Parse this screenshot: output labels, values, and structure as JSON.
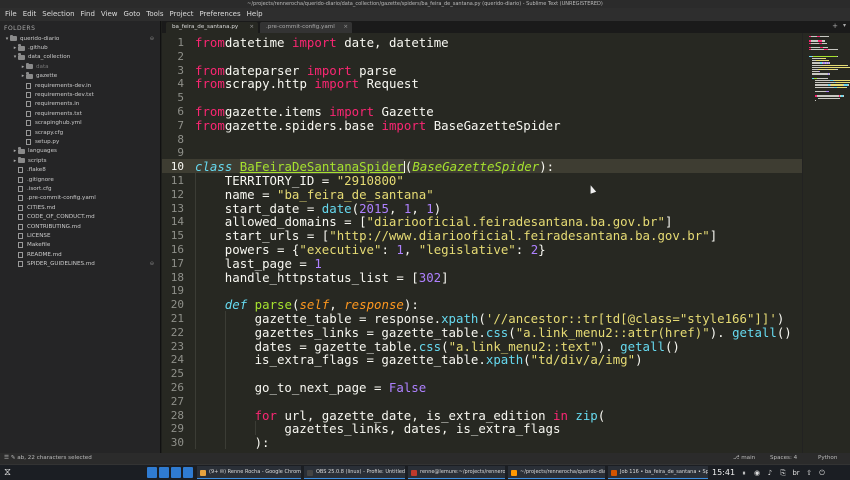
{
  "window": {
    "title": "~/projects/rennerocha/querido-diario/data_collection/gazette/spiders/ba_feira_de_santana.py (querido-diario) - Sublime Text (UNREGISTERED)"
  },
  "menu": [
    "File",
    "Edit",
    "Selection",
    "Find",
    "View",
    "Goto",
    "Tools",
    "Project",
    "Preferences",
    "Help"
  ],
  "sidebar": {
    "heading": "FOLDERS",
    "items": [
      {
        "label": "querido-diario",
        "kind": "folder",
        "depth": 0,
        "expanded": true,
        "close": "⊖"
      },
      {
        "label": ".github",
        "kind": "folder",
        "depth": 1,
        "expanded": false
      },
      {
        "label": "data_collection",
        "kind": "folder",
        "depth": 1,
        "expanded": true
      },
      {
        "label": "data",
        "kind": "folder",
        "depth": 2,
        "expanded": false,
        "dim": true
      },
      {
        "label": "gazette",
        "kind": "folder",
        "depth": 2,
        "expanded": false
      },
      {
        "label": "requirements-dev.in",
        "kind": "file",
        "depth": 2
      },
      {
        "label": "requirements-dev.txt",
        "kind": "file",
        "depth": 2
      },
      {
        "label": "requirements.in",
        "kind": "file",
        "depth": 2
      },
      {
        "label": "requirements.txt",
        "kind": "file",
        "depth": 2
      },
      {
        "label": "scrapinghub.yml",
        "kind": "file",
        "depth": 2
      },
      {
        "label": "scrapy.cfg",
        "kind": "file",
        "depth": 2
      },
      {
        "label": "setup.py",
        "kind": "file",
        "depth": 2
      },
      {
        "label": "languages",
        "kind": "folder",
        "depth": 1,
        "expanded": false
      },
      {
        "label": "scripts",
        "kind": "folder",
        "depth": 1,
        "expanded": false
      },
      {
        "label": ".flake8",
        "kind": "file",
        "depth": 1
      },
      {
        "label": ".gitignore",
        "kind": "file",
        "depth": 1
      },
      {
        "label": ".isort.cfg",
        "kind": "file",
        "depth": 1
      },
      {
        "label": ".pre-commit-config.yaml",
        "kind": "file",
        "depth": 1
      },
      {
        "label": "CITIES.md",
        "kind": "file",
        "depth": 1
      },
      {
        "label": "CODE_OF_CONDUCT.md",
        "kind": "file",
        "depth": 1
      },
      {
        "label": "CONTRIBUTING.md",
        "kind": "file",
        "depth": 1
      },
      {
        "label": "LICENSE",
        "kind": "file",
        "depth": 1
      },
      {
        "label": "Makefile",
        "kind": "file",
        "depth": 1
      },
      {
        "label": "README.md",
        "kind": "file",
        "depth": 1
      },
      {
        "label": "SPIDER_GUIDELINES.md",
        "kind": "file",
        "depth": 1,
        "close": "⊖"
      }
    ]
  },
  "tabs": {
    "active": "ba_feira_de_santana.py",
    "inactive": ".pre-commit-config.yaml",
    "close_glyph": "×",
    "add_glyph": "+",
    "list_glyph": "▾"
  },
  "editor": {
    "current_line": 10,
    "lines": [
      {
        "n": 1,
        "indent": 0,
        "tokens": [
          [
            "kw",
            "from"
          ],
          [
            "",
            "datetime "
          ],
          [
            "kw",
            "import"
          ],
          [
            "",
            " date, datetime"
          ]
        ]
      },
      {
        "n": 2,
        "indent": 0,
        "tokens": []
      },
      {
        "n": 3,
        "indent": 0,
        "tokens": [
          [
            "kw",
            "from"
          ],
          [
            "",
            "dateparser "
          ],
          [
            "kw",
            "import"
          ],
          [
            "",
            " parse"
          ]
        ]
      },
      {
        "n": 4,
        "indent": 0,
        "tokens": [
          [
            "kw",
            "from"
          ],
          [
            "",
            "scrapy.http "
          ],
          [
            "kw",
            "import"
          ],
          [
            "",
            " Request"
          ]
        ]
      },
      {
        "n": 5,
        "indent": 0,
        "tokens": []
      },
      {
        "n": 6,
        "indent": 0,
        "tokens": [
          [
            "kw",
            "from"
          ],
          [
            "",
            "gazette.items "
          ],
          [
            "kw",
            "import"
          ],
          [
            "",
            " Gazette"
          ]
        ]
      },
      {
        "n": 7,
        "indent": 0,
        "tokens": [
          [
            "kw",
            "from"
          ],
          [
            "",
            "gazette.spiders.base "
          ],
          [
            "kw",
            "import"
          ],
          [
            "",
            " BaseGazetteSpider"
          ]
        ]
      },
      {
        "n": 8,
        "indent": 0,
        "tokens": []
      },
      {
        "n": 9,
        "indent": 0,
        "tokens": []
      },
      {
        "n": 10,
        "indent": 0,
        "tokens": [
          [
            "ital",
            "class"
          ],
          [
            "",
            " "
          ],
          [
            "cls sel",
            "BaFeiraDeSantanaSpider"
          ],
          [
            "caret",
            ""
          ],
          [
            "",
            "("
          ],
          [
            "inh",
            "BaseGazetteSpider"
          ],
          [
            "",
            "):"
          ]
        ]
      },
      {
        "n": 11,
        "indent": 1,
        "tokens": [
          [
            "",
            "TERRITORY_ID = "
          ],
          [
            "str",
            "\"2910800\""
          ]
        ]
      },
      {
        "n": 12,
        "indent": 1,
        "tokens": [
          [
            "",
            "name = "
          ],
          [
            "str",
            "\"ba_feira_de_santana\""
          ]
        ]
      },
      {
        "n": 13,
        "indent": 1,
        "tokens": [
          [
            "",
            "start_date = "
          ],
          [
            "call",
            "date"
          ],
          [
            "",
            "("
          ],
          [
            "num",
            "2015"
          ],
          [
            "",
            ", "
          ],
          [
            "num",
            "1"
          ],
          [
            "",
            ", "
          ],
          [
            "num",
            "1"
          ],
          [
            "",
            ")"
          ]
        ]
      },
      {
        "n": 14,
        "indent": 1,
        "tokens": [
          [
            "",
            "allowed_domains = ["
          ],
          [
            "str",
            "\"diariooficial.feiradesantana.ba.gov.br\""
          ],
          [
            "",
            "]"
          ]
        ]
      },
      {
        "n": 15,
        "indent": 1,
        "tokens": [
          [
            "",
            "start_urls = ["
          ],
          [
            "str",
            "\"http://www.diariooficial.feiradesantana.ba.gov.br\""
          ],
          [
            "",
            "]"
          ]
        ]
      },
      {
        "n": 16,
        "indent": 1,
        "tokens": [
          [
            "",
            "powers = {"
          ],
          [
            "str",
            "\"executive\""
          ],
          [
            "",
            ": "
          ],
          [
            "num",
            "1"
          ],
          [
            "",
            ", "
          ],
          [
            "str",
            "\"legislative\""
          ],
          [
            "",
            ": "
          ],
          [
            "num",
            "2"
          ],
          [
            "",
            "}"
          ]
        ]
      },
      {
        "n": 17,
        "indent": 1,
        "tokens": [
          [
            "",
            "last_page = "
          ],
          [
            "num",
            "1"
          ]
        ]
      },
      {
        "n": 18,
        "indent": 1,
        "tokens": [
          [
            "",
            "handle_httpstatus_list = ["
          ],
          [
            "num",
            "302"
          ],
          [
            "",
            "]"
          ]
        ]
      },
      {
        "n": 19,
        "indent": 1,
        "tokens": []
      },
      {
        "n": 20,
        "indent": 1,
        "tokens": [
          [
            "ital",
            "def"
          ],
          [
            "",
            " "
          ],
          [
            "fn",
            "parse"
          ],
          [
            "",
            "("
          ],
          [
            "par",
            "self"
          ],
          [
            "",
            ", "
          ],
          [
            "par",
            "response"
          ],
          [
            "",
            "):"
          ]
        ]
      },
      {
        "n": 21,
        "indent": 2,
        "tokens": [
          [
            "",
            "gazette_table = response."
          ],
          [
            "call",
            "xpath"
          ],
          [
            "",
            "("
          ],
          [
            "str",
            "'//ancestor::tr[td[@class=\"style166\"]]'"
          ],
          [
            "",
            ")"
          ]
        ]
      },
      {
        "n": 22,
        "indent": 2,
        "tokens": [
          [
            "",
            "gazettes_links = gazette_table."
          ],
          [
            "call",
            "css"
          ],
          [
            "",
            "("
          ],
          [
            "str",
            "\"a.link_menu2::attr(href)\""
          ],
          [
            "",
            "). "
          ],
          [
            "call",
            "getall"
          ],
          [
            "",
            "()"
          ]
        ]
      },
      {
        "n": 23,
        "indent": 2,
        "tokens": [
          [
            "",
            "dates = gazette_table."
          ],
          [
            "call",
            "css"
          ],
          [
            "",
            "("
          ],
          [
            "str",
            "\"a.link_menu2::text\""
          ],
          [
            "",
            "). "
          ],
          [
            "call",
            "getall"
          ],
          [
            "",
            "()"
          ]
        ]
      },
      {
        "n": 24,
        "indent": 2,
        "tokens": [
          [
            "",
            "is_extra_flags = gazette_table."
          ],
          [
            "call",
            "xpath"
          ],
          [
            "",
            "("
          ],
          [
            "str",
            "\"td/div/a/img\""
          ],
          [
            "",
            ")"
          ]
        ]
      },
      {
        "n": 25,
        "indent": 2,
        "tokens": []
      },
      {
        "n": 26,
        "indent": 2,
        "tokens": [
          [
            "",
            "go_to_next_page = "
          ],
          [
            "num",
            "False"
          ]
        ]
      },
      {
        "n": 27,
        "indent": 2,
        "tokens": []
      },
      {
        "n": 28,
        "indent": 2,
        "tokens": [
          [
            "kw",
            "for"
          ],
          [
            "",
            " url, gazette_date, is_extra_edition "
          ],
          [
            "kw",
            "in"
          ],
          [
            "",
            " "
          ],
          [
            "call",
            "zip"
          ],
          [
            "",
            "("
          ]
        ]
      },
      {
        "n": 29,
        "indent": 3,
        "tokens": [
          [
            "",
            "gazettes_links, dates, is_extra_flags"
          ]
        ]
      },
      {
        "n": 30,
        "indent": 2,
        "tokens": [
          [
            "",
            "):"
          ]
        ]
      }
    ]
  },
  "status": {
    "left": "☰  ✎  ab, 22 characters selected",
    "branch": "⎇ main",
    "spaces": "Spaces: 4",
    "syntax": "Python"
  },
  "taskbar": {
    "tasks": [
      {
        "label": "(9+ ✉) Renne Rocha - Google Chrome",
        "color": "#e8a33d"
      },
      {
        "label": "OBS 25.0.8 (linux) - Profile: Untitled - Sc...",
        "color": "#444"
      },
      {
        "label": "renne@lemure:~/projects/rennerocha/...",
        "color": "#c0392b"
      },
      {
        "label": "~/projects/rennerocha/querido-diario/d...",
        "color": "#ff9800"
      },
      {
        "label": "Job 116 • ba_feira_de_santana • Spider...",
        "color": "#d35400"
      }
    ],
    "clock": "15:41",
    "tray": [
      "⏸",
      "◉",
      "♪",
      "⎘",
      "br",
      "⇧",
      "⏻"
    ]
  }
}
